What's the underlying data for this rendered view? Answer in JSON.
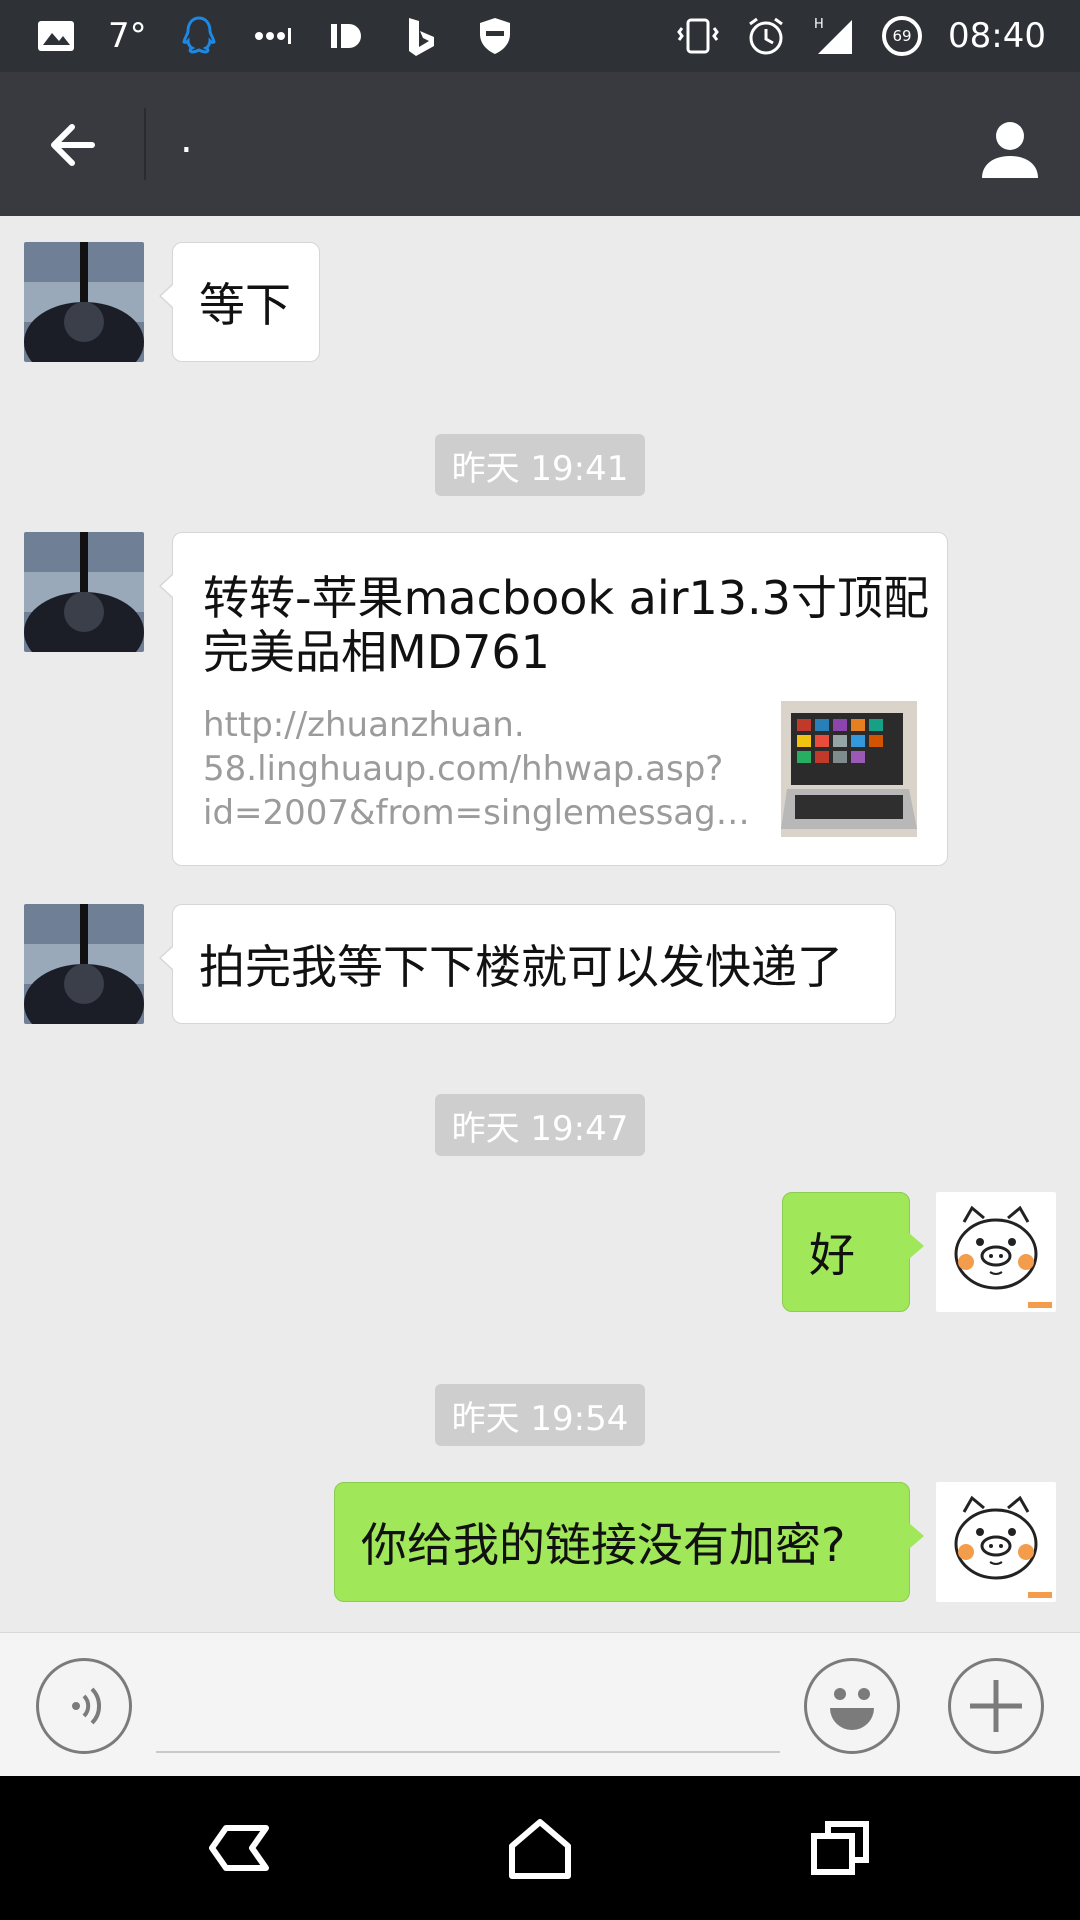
{
  "status_bar": {
    "temperature": "7°",
    "signal_type": "H",
    "battery_level": "69",
    "time": "08:40"
  },
  "header": {
    "title": "."
  },
  "messages": [
    {
      "type": "text",
      "direction": "in",
      "text": "等下"
    },
    {
      "type": "timestamp",
      "text": "昨天 19:41"
    },
    {
      "type": "link",
      "direction": "in",
      "title": "转转-苹果macbook air13.3寸顶配完美品相MD761",
      "url_lines": [
        "http://zhuanzhuan.",
        "58.linghuaup.com/hhwap.asp?",
        "id=2007&from=singlemessage&i..."
      ]
    },
    {
      "type": "text",
      "direction": "in",
      "text": "拍完我等下下楼就可以发快递了"
    },
    {
      "type": "timestamp",
      "text": "昨天 19:47"
    },
    {
      "type": "text",
      "direction": "out",
      "text": "好"
    },
    {
      "type": "timestamp",
      "text": "昨天 19:54"
    },
    {
      "type": "text",
      "direction": "out",
      "text": "你给我的链接没有加密?"
    }
  ],
  "input": {
    "placeholder": ""
  },
  "colors": {
    "statusbar_bg": "#2e3135",
    "titlebar_bg": "#393a3f",
    "chat_bg": "#ebebeb",
    "outgoing_bubble": "#a0e75a",
    "incoming_bubble": "#ffffff",
    "timestamp_bg": "#cecece"
  },
  "icons": {
    "status_left": [
      "image-icon",
      "qq-icon",
      "more-dots-icon",
      "id-icon",
      "bing-icon",
      "shield-icon"
    ],
    "status_right": [
      "vibrate-icon",
      "alarm-icon",
      "signal-icon",
      "battery-icon"
    ],
    "header": [
      "back-arrow-icon",
      "profile-icon"
    ],
    "input": [
      "voice-icon",
      "emoji-icon",
      "plus-icon"
    ],
    "nav": [
      "nav-back-icon",
      "nav-home-icon",
      "nav-recents-icon"
    ]
  }
}
